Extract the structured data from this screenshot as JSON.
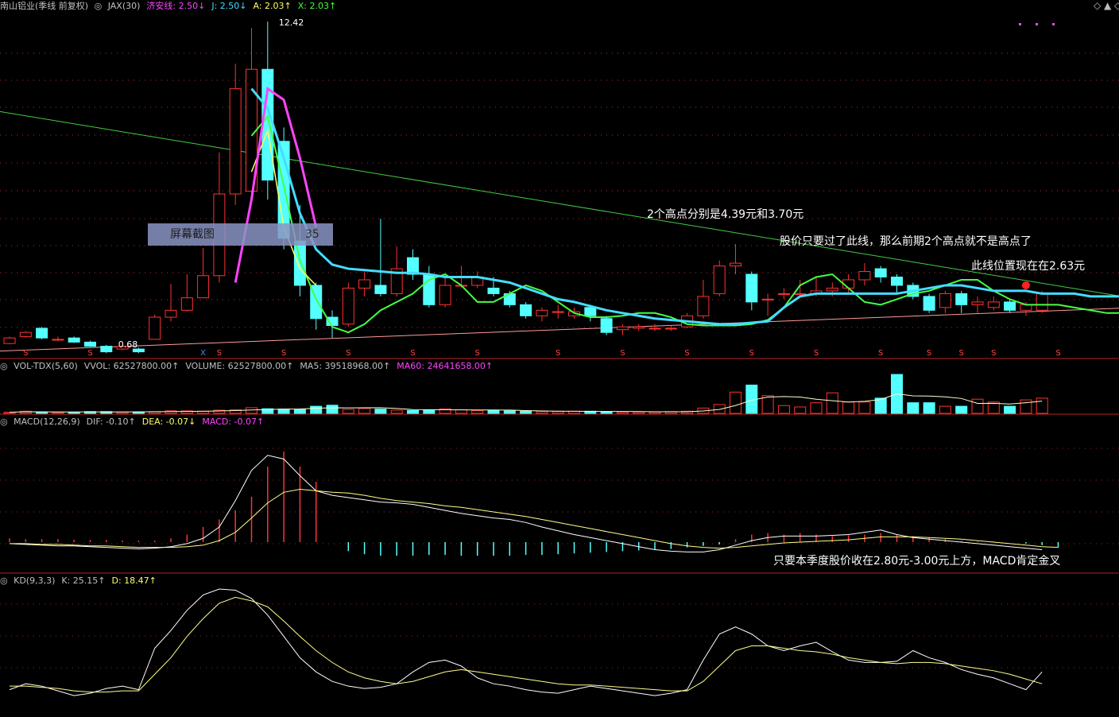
{
  "main_header": {
    "title": "南山铝业(季线 前复权)",
    "items": [
      {
        "label": "JAX(30)",
        "color": "#c0c0c0"
      },
      {
        "label": "济安线: 2.50↓",
        "color": "#ff44ff"
      },
      {
        "label": "J: 2.50↓",
        "color": "#44ddff"
      },
      {
        "label": "A: 2.03↑",
        "color": "#ffff66"
      },
      {
        "label": "X: 2.03↑",
        "color": "#44ff44"
      }
    ],
    "window_icons": {
      "left": "◇",
      "up": "▲",
      "right": "◇"
    }
  },
  "vol_header": {
    "items": [
      {
        "label": "VOL-TDX(5,60)",
        "color": "#c0c0c0"
      },
      {
        "label": "VVOL: 62527800.00↑",
        "color": "#c0c0c0"
      },
      {
        "label": "VOLUME: 62527800.00↑",
        "color": "#c0c0c0"
      },
      {
        "label": "MA5: 39518968.00↑",
        "color": "#c0c0c0"
      },
      {
        "label": "MA60: 24641658.00↑",
        "color": "#ff44ff"
      }
    ]
  },
  "macd_header": {
    "items": [
      {
        "label": "MACD(12,26,9)",
        "color": "#c0c0c0"
      },
      {
        "label": "DIF: -0.10↑",
        "color": "#c0c0c0"
      },
      {
        "label": "DEA: -0.07↓",
        "color": "#ffff66"
      },
      {
        "label": "MACD: -0.07↑",
        "color": "#ff44ff"
      }
    ]
  },
  "kd_header": {
    "items": [
      {
        "label": "KD(9,3,3)",
        "color": "#c0c0c0"
      },
      {
        "label": "K: 25.15↑",
        "color": "#c0c0c0"
      },
      {
        "label": "D: 18.47↑",
        "color": "#ffff66"
      }
    ]
  },
  "annotations": {
    "peaks": "2个高点分别是4.39元和3.70元",
    "breakout": "股价只要过了此线，那么前期2个高点就不是高点了",
    "line_now": "此线位置现在在2.63元",
    "macd_note": "只要本季度股价收在2.80元-3.00元上方，MACD肯定金叉",
    "high_label": "12.42",
    "low_label": "0.68"
  },
  "overlay": {
    "title": "屏幕截图",
    "number": "35"
  },
  "colors": {
    "up": "#ff3232",
    "down": "#54ffff",
    "grid": "#7a0000",
    "dotted": "#ff4444",
    "line_j": "#44ddff",
    "line_jax": "#ff44ff",
    "line_a": "#ffff66",
    "line_x": "#44ff44",
    "trend": "#44cc44",
    "support": "#ff9a9a"
  },
  "chart_data": {
    "type": "candlestick",
    "title": "南山铝业(季线 前复权)",
    "ylim": [
      0,
      14
    ],
    "candles": [
      {
        "o": 0.8,
        "c": 1.0,
        "h": 1.05,
        "l": 0.78
      },
      {
        "o": 1.05,
        "c": 1.2,
        "h": 1.25,
        "l": 1.0
      },
      {
        "o": 1.35,
        "c": 1.0,
        "h": 1.4,
        "l": 0.95
      },
      {
        "o": 0.95,
        "c": 0.95,
        "h": 1.05,
        "l": 0.88
      },
      {
        "o": 1.0,
        "c": 0.85,
        "h": 1.05,
        "l": 0.82
      },
      {
        "o": 0.85,
        "c": 0.7,
        "h": 0.9,
        "l": 0.68
      },
      {
        "o": 0.7,
        "c": 0.5,
        "h": 0.75,
        "l": 0.45
      },
      {
        "o": 0.6,
        "c": 0.7,
        "h": 0.75,
        "l": 0.55
      },
      {
        "o": 0.6,
        "c": 0.5,
        "h": 0.65,
        "l": 0.45
      },
      {
        "o": 0.95,
        "c": 1.75,
        "h": 1.85,
        "l": 0.95
      },
      {
        "o": 1.75,
        "c": 2.0,
        "h": 2.95,
        "l": 1.6
      },
      {
        "o": 2.0,
        "c": 2.45,
        "h": 3.3,
        "l": 1.95
      },
      {
        "o": 2.45,
        "c": 3.25,
        "h": 4.25,
        "l": 2.45
      },
      {
        "o": 3.25,
        "c": 6.2,
        "h": 7.7,
        "l": 3.0
      },
      {
        "o": 6.2,
        "c": 10.0,
        "h": 10.9,
        "l": 5.8
      },
      {
        "o": 6.3,
        "c": 10.7,
        "h": 12.2,
        "l": 6.1
      },
      {
        "o": 10.7,
        "c": 6.7,
        "h": 12.42,
        "l": 6.0
      },
      {
        "o": 8.1,
        "c": 4.6,
        "h": 8.6,
        "l": 4.2
      },
      {
        "o": 4.5,
        "c": 2.9,
        "h": 5.8,
        "l": 2.5
      },
      {
        "o": 2.9,
        "c": 1.7,
        "h": 3.0,
        "l": 1.3
      },
      {
        "o": 1.75,
        "c": 1.45,
        "h": 2.0,
        "l": 1.0
      },
      {
        "o": 1.5,
        "c": 2.8,
        "h": 3.0,
        "l": 1.4
      },
      {
        "o": 2.8,
        "c": 3.1,
        "h": 3.4,
        "l": 2.5
      },
      {
        "o": 2.9,
        "c": 2.6,
        "h": 5.3,
        "l": 2.5
      },
      {
        "o": 2.6,
        "c": 3.5,
        "h": 4.3,
        "l": 2.5
      },
      {
        "o": 3.9,
        "c": 3.3,
        "h": 4.2,
        "l": 3.1
      },
      {
        "o": 3.3,
        "c": 2.2,
        "h": 3.6,
        "l": 2.1
      },
      {
        "o": 2.2,
        "c": 2.9,
        "h": 3.2,
        "l": 2.1
      },
      {
        "o": 2.9,
        "c": 2.9,
        "h": 3.6,
        "l": 2.8
      },
      {
        "o": 2.9,
        "c": 3.2,
        "h": 3.4,
        "l": 2.8
      },
      {
        "o": 2.8,
        "c": 2.6,
        "h": 3.2,
        "l": 2.5
      },
      {
        "o": 2.6,
        "c": 2.2,
        "h": 2.7,
        "l": 2.1
      },
      {
        "o": 2.2,
        "c": 1.8,
        "h": 2.3,
        "l": 1.7
      },
      {
        "o": 1.8,
        "c": 2.0,
        "h": 2.1,
        "l": 1.6
      },
      {
        "o": 1.95,
        "c": 1.95,
        "h": 2.2,
        "l": 1.7
      },
      {
        "o": 1.8,
        "c": 1.95,
        "h": 2.1,
        "l": 1.7
      },
      {
        "o": 2.1,
        "c": 1.8,
        "h": 2.2,
        "l": 1.6
      },
      {
        "o": 1.7,
        "c": 1.2,
        "h": 1.8,
        "l": 1.1
      },
      {
        "o": 1.3,
        "c": 1.4,
        "h": 1.5,
        "l": 1.1
      },
      {
        "o": 1.35,
        "c": 1.4,
        "h": 1.5,
        "l": 1.25
      },
      {
        "o": 1.35,
        "c": 1.35,
        "h": 1.5,
        "l": 1.25
      },
      {
        "o": 1.35,
        "c": 1.35,
        "h": 1.45,
        "l": 1.25
      },
      {
        "o": 1.4,
        "c": 1.8,
        "h": 1.9,
        "l": 1.35
      },
      {
        "o": 1.8,
        "c": 2.5,
        "h": 3.1,
        "l": 1.7
      },
      {
        "o": 2.6,
        "c": 3.6,
        "h": 3.8,
        "l": 2.5
      },
      {
        "o": 3.6,
        "c": 3.7,
        "h": 4.39,
        "l": 3.3
      },
      {
        "o": 3.3,
        "c": 2.3,
        "h": 3.4,
        "l": 2.0
      },
      {
        "o": 2.4,
        "c": 2.4,
        "h": 2.6,
        "l": 1.8
      },
      {
        "o": 2.6,
        "c": 2.6,
        "h": 2.8,
        "l": 2.4
      },
      {
        "o": 2.6,
        "c": 2.6,
        "h": 3.1,
        "l": 2.5
      },
      {
        "o": 2.6,
        "c": 2.7,
        "h": 3.2,
        "l": 2.5
      },
      {
        "o": 2.7,
        "c": 2.8,
        "h": 3.0,
        "l": 2.5
      },
      {
        "o": 2.8,
        "c": 3.1,
        "h": 3.3,
        "l": 2.6
      },
      {
        "o": 3.1,
        "c": 3.4,
        "h": 3.7,
        "l": 2.9
      },
      {
        "o": 3.5,
        "c": 3.2,
        "h": 3.6,
        "l": 3.0
      },
      {
        "o": 3.2,
        "c": 2.9,
        "h": 3.3,
        "l": 2.6
      },
      {
        "o": 2.9,
        "c": 2.5,
        "h": 3.0,
        "l": 2.4
      },
      {
        "o": 2.5,
        "c": 2.0,
        "h": 2.6,
        "l": 1.9
      },
      {
        "o": 2.1,
        "c": 2.6,
        "h": 2.7,
        "l": 1.9
      },
      {
        "o": 2.6,
        "c": 2.2,
        "h": 2.7,
        "l": 1.9
      },
      {
        "o": 2.2,
        "c": 2.3,
        "h": 2.5,
        "l": 1.9
      },
      {
        "o": 2.1,
        "c": 2.3,
        "h": 2.5,
        "l": 2.0
      },
      {
        "o": 2.3,
        "c": 2.0,
        "h": 2.4,
        "l": 1.9
      },
      {
        "o": 2.0,
        "c": 2.2,
        "h": 2.3,
        "l": 1.8
      },
      {
        "o": 2.0,
        "c": 2.6,
        "h": 2.7,
        "l": 1.9
      }
    ],
    "volume": [
      0.3,
      0.6,
      0.4,
      0.3,
      0.3,
      0.5,
      0.5,
      0.4,
      0.4,
      0.5,
      0.7,
      0.7,
      0.6,
      0.9,
      1.0,
      1.6,
      1.3,
      1.2,
      1.1,
      2.0,
      2.3,
      1.1,
      1.4,
      1.2,
      0.9,
      0.8,
      0.9,
      1.3,
      1.0,
      0.8,
      0.8,
      0.7,
      0.6,
      0.5,
      0.5,
      0.6,
      0.6,
      0.5,
      0.4,
      0.4,
      0.4,
      0.5,
      0.6,
      1.5,
      2.5,
      6.0,
      8.0,
      5.0,
      2.2,
      1.8,
      3.0,
      5.8,
      3.2,
      3.2,
      4.3,
      11.0,
      3.0,
      3.0,
      2.0,
      2.0,
      4.0,
      3.2,
      2.0,
      3.8,
      4.3
    ],
    "lines": {
      "jax": {
        "start": 14,
        "values": [
          3.0,
          6.0,
          10.0,
          9.6,
          7.5,
          5.0
        ]
      },
      "j": {
        "start": 15,
        "values": [
          10.0,
          9.3,
          7.5,
          5.5,
          4.2,
          3.65,
          3.5,
          3.45,
          3.4,
          3.35,
          3.35,
          3.3,
          3.2,
          3.2,
          3.2,
          3.1,
          3.0,
          2.8,
          2.6,
          2.4,
          2.3,
          2.15,
          2.0,
          1.9,
          1.8,
          1.7,
          1.65,
          1.6,
          1.55,
          1.5,
          1.5,
          1.55,
          1.6,
          2.1,
          2.5,
          2.6,
          2.6,
          2.6,
          2.6,
          2.6,
          2.6,
          2.7,
          2.8,
          2.9,
          2.9,
          2.8,
          2.7,
          2.7,
          2.7,
          2.6,
          2.6,
          2.6,
          2.5,
          2.5,
          2.5
        ]
      },
      "a": {
        "start": 15,
        "values": [
          7.0,
          8.5,
          5.0,
          3.5,
          2.9
        ]
      },
      "x": {
        "start": 15,
        "values": [
          8.3,
          9.0,
          6.5,
          3.8,
          2.4,
          1.4,
          1.2,
          1.5,
          2.0,
          2.3,
          2.6,
          3.1,
          3.3,
          2.9,
          2.3,
          2.3,
          2.6,
          2.9,
          2.7,
          2.3,
          1.9,
          1.75,
          1.75,
          1.8,
          1.9,
          1.9,
          1.75,
          1.5,
          1.45,
          1.45,
          1.45,
          1.5,
          1.65,
          2.1,
          2.9,
          3.2,
          3.3,
          2.8,
          2.3,
          2.2,
          2.4,
          2.6,
          2.7,
          2.9,
          3.1,
          3.1,
          2.7,
          2.4,
          2.2,
          2.2,
          2.2,
          2.1,
          2.0,
          1.9,
          1.9
        ]
      },
      "trend": {
        "from": [
          -4,
          9.5
        ],
        "to": [
          70,
          2.4
        ]
      },
      "support": {
        "from": [
          -4,
          0.45
        ],
        "to": [
          70,
          2.1
        ]
      }
    },
    "markers": {
      "s_indices": [
        1,
        5,
        13,
        17,
        21,
        25,
        29,
        34,
        38,
        42,
        46,
        50,
        54,
        57,
        59,
        61,
        65
      ],
      "x_indices": [
        12
      ]
    },
    "macd": {
      "dif": [
        -0.02,
        -0.03,
        -0.04,
        -0.05,
        -0.05,
        -0.06,
        -0.07,
        -0.08,
        -0.09,
        -0.08,
        -0.06,
        -0.02,
        0.05,
        0.2,
        0.55,
        0.95,
        1.15,
        1.1,
        0.88,
        0.68,
        0.62,
        0.59,
        0.56,
        0.53,
        0.52,
        0.5,
        0.46,
        0.42,
        0.38,
        0.35,
        0.32,
        0.3,
        0.26,
        0.2,
        0.15,
        0.1,
        0.06,
        0.02,
        -0.02,
        -0.06,
        -0.1,
        -0.12,
        -0.13,
        -0.13,
        -0.1,
        -0.04,
        0.02,
        0.06,
        0.08,
        0.08,
        0.08,
        0.09,
        0.1,
        0.13,
        0.16,
        0.1,
        0.06,
        0.04,
        0.02,
        0.0,
        -0.02,
        -0.04,
        -0.06,
        -0.08,
        -0.1
      ],
      "dea": [
        -0.02,
        -0.02,
        -0.03,
        -0.03,
        -0.04,
        -0.05,
        -0.05,
        -0.06,
        -0.07,
        -0.07,
        -0.07,
        -0.06,
        -0.04,
        0.02,
        0.13,
        0.32,
        0.52,
        0.66,
        0.7,
        0.68,
        0.66,
        0.65,
        0.62,
        0.58,
        0.55,
        0.53,
        0.51,
        0.48,
        0.46,
        0.43,
        0.4,
        0.37,
        0.34,
        0.3,
        0.26,
        0.22,
        0.18,
        0.14,
        0.1,
        0.06,
        0.02,
        -0.02,
        -0.05,
        -0.07,
        -0.08,
        -0.07,
        -0.05,
        -0.03,
        -0.01,
        0.0,
        0.01,
        0.02,
        0.03,
        0.05,
        0.07,
        0.07,
        0.07,
        0.06,
        0.05,
        0.04,
        0.02,
        0.0,
        -0.02,
        -0.04,
        -0.06,
        -0.07
      ],
      "bar": [
        0.05,
        0.04,
        0.04,
        0.04,
        0.03,
        0.03,
        0.03,
        0.02,
        0.02,
        0.02,
        0.05,
        0.1,
        0.2,
        0.3,
        0.42,
        0.6,
        1.0,
        1.2,
        1.0,
        0.8,
        0.0,
        -0.12,
        -0.16,
        -0.18,
        -0.18,
        -0.18,
        -0.17,
        -0.17,
        -0.18,
        -0.18,
        -0.18,
        -0.18,
        -0.17,
        -0.17,
        -0.16,
        -0.15,
        -0.14,
        -0.13,
        -0.12,
        -0.11,
        -0.1,
        -0.09,
        -0.07,
        -0.05,
        -0.03,
        0.04,
        0.1,
        0.12,
        0.1,
        0.12,
        0.1,
        0.08,
        0.09,
        0.1,
        0.12,
        0.1,
        0.08,
        0.06,
        0.04,
        0.02,
        0.01,
        0.01,
        0.0,
        -0.02,
        -0.04,
        -0.07
      ],
      "ylim": [
        -0.2,
        1.3
      ]
    },
    "kd": {
      "k": [
        15,
        20,
        18,
        14,
        10,
        12,
        16,
        18,
        15,
        50,
        65,
        82,
        95,
        100,
        99,
        92,
        78,
        60,
        42,
        30,
        22,
        18,
        16,
        17,
        20,
        30,
        38,
        40,
        35,
        25,
        20,
        18,
        15,
        13,
        12,
        15,
        18,
        16,
        14,
        12,
        10,
        12,
        15,
        40,
        62,
        68,
        62,
        52,
        48,
        52,
        55,
        47,
        40,
        38,
        38,
        39,
        48,
        42,
        38,
        32,
        28,
        25,
        20,
        15,
        30
      ],
      "d": [
        18,
        18,
        17,
        16,
        14,
        13,
        13,
        14,
        14,
        28,
        42,
        60,
        75,
        88,
        93,
        90,
        85,
        73,
        60,
        48,
        38,
        30,
        25,
        22,
        20,
        22,
        26,
        30,
        32,
        30,
        28,
        26,
        24,
        22,
        20,
        19,
        19,
        18,
        17,
        16,
        15,
        14,
        14,
        22,
        35,
        48,
        52,
        52,
        50,
        48,
        47,
        45,
        42,
        40,
        38,
        37,
        38,
        38,
        37,
        35,
        33,
        31,
        28,
        24,
        20
      ],
      "ylim": [
        0,
        100
      ]
    }
  }
}
